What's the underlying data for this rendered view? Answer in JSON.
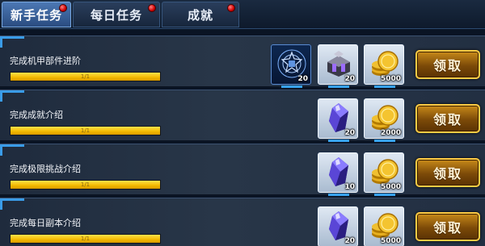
{
  "tabs": [
    {
      "label": "新手任务",
      "active": true,
      "badge": true
    },
    {
      "label": "每日任务",
      "active": false,
      "badge": true
    },
    {
      "label": "成就",
      "active": false,
      "badge": true
    }
  ],
  "tasks": [
    {
      "title": "完成机甲部件进阶",
      "progress_text": "1/1",
      "progress": 1.0,
      "rewards": [
        {
          "icon": "mech-blueprint-icon",
          "count": "20"
        },
        {
          "icon": "mech-part-icon",
          "count": "20"
        },
        {
          "icon": "gold-coins-icon",
          "count": "5000"
        }
      ],
      "claim_label": "领取"
    },
    {
      "title": "完成成就介绍",
      "progress_text": "1/1",
      "progress": 1.0,
      "rewards": [
        {
          "icon": "crystal-icon",
          "count": "20"
        },
        {
          "icon": "gold-coins-icon",
          "count": "2000"
        }
      ],
      "claim_label": "领取"
    },
    {
      "title": "完成极限挑战介绍",
      "progress_text": "1/1",
      "progress": 1.0,
      "rewards": [
        {
          "icon": "crystal-icon",
          "count": "10"
        },
        {
          "icon": "gold-coins-icon",
          "count": "5000"
        }
      ],
      "claim_label": "领取"
    },
    {
      "title": "完成每日副本介绍",
      "progress_text": "1/1",
      "progress": 1.0,
      "rewards": [
        {
          "icon": "crystal-icon",
          "count": "20"
        },
        {
          "icon": "gold-coins-icon",
          "count": "5000"
        }
      ],
      "claim_label": "领取"
    }
  ],
  "colors": {
    "progress": "#f2b800",
    "accent": "#3a9ce8",
    "claim_border": "#ffcc44",
    "badge": "#d00000"
  }
}
